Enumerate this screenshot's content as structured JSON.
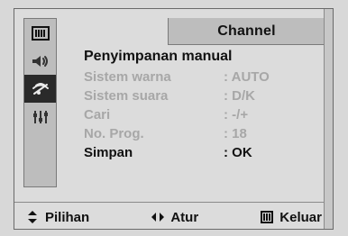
{
  "header": {
    "title": "Channel"
  },
  "left_rail": {
    "items": [
      {
        "icon": "picture-icon",
        "active": false
      },
      {
        "icon": "sound-icon",
        "active": false
      },
      {
        "icon": "antenna-icon",
        "active": true
      },
      {
        "icon": "setup-sliders-icon",
        "active": false
      }
    ]
  },
  "main": {
    "section_title": "Penyimpanan manual",
    "rows": [
      {
        "label": "Sistem warna",
        "value": ": AUTO",
        "enabled": false
      },
      {
        "label": "Sistem suara",
        "value": ": D/K",
        "enabled": false
      },
      {
        "label": "Cari",
        "value": ": -/+",
        "enabled": false
      },
      {
        "label": "No. Prog.",
        "value": ": 18",
        "enabled": false
      },
      {
        "label": "Simpan",
        "value": ": OK",
        "enabled": true
      }
    ]
  },
  "footer": {
    "items": [
      {
        "icon": "updown-arrows-icon",
        "label": "Pilihan"
      },
      {
        "icon": "leftright-arrows-icon",
        "label": "Atur"
      },
      {
        "icon": "menu-icon",
        "label": "Keluar"
      }
    ]
  },
  "colors": {
    "background": "#d8d8d8",
    "panel": "#dcdcdc",
    "rail": "#bdbdbd",
    "active_rail": "#2a2a2a",
    "disabled_text": "#a7a7a7",
    "text": "#111111"
  }
}
